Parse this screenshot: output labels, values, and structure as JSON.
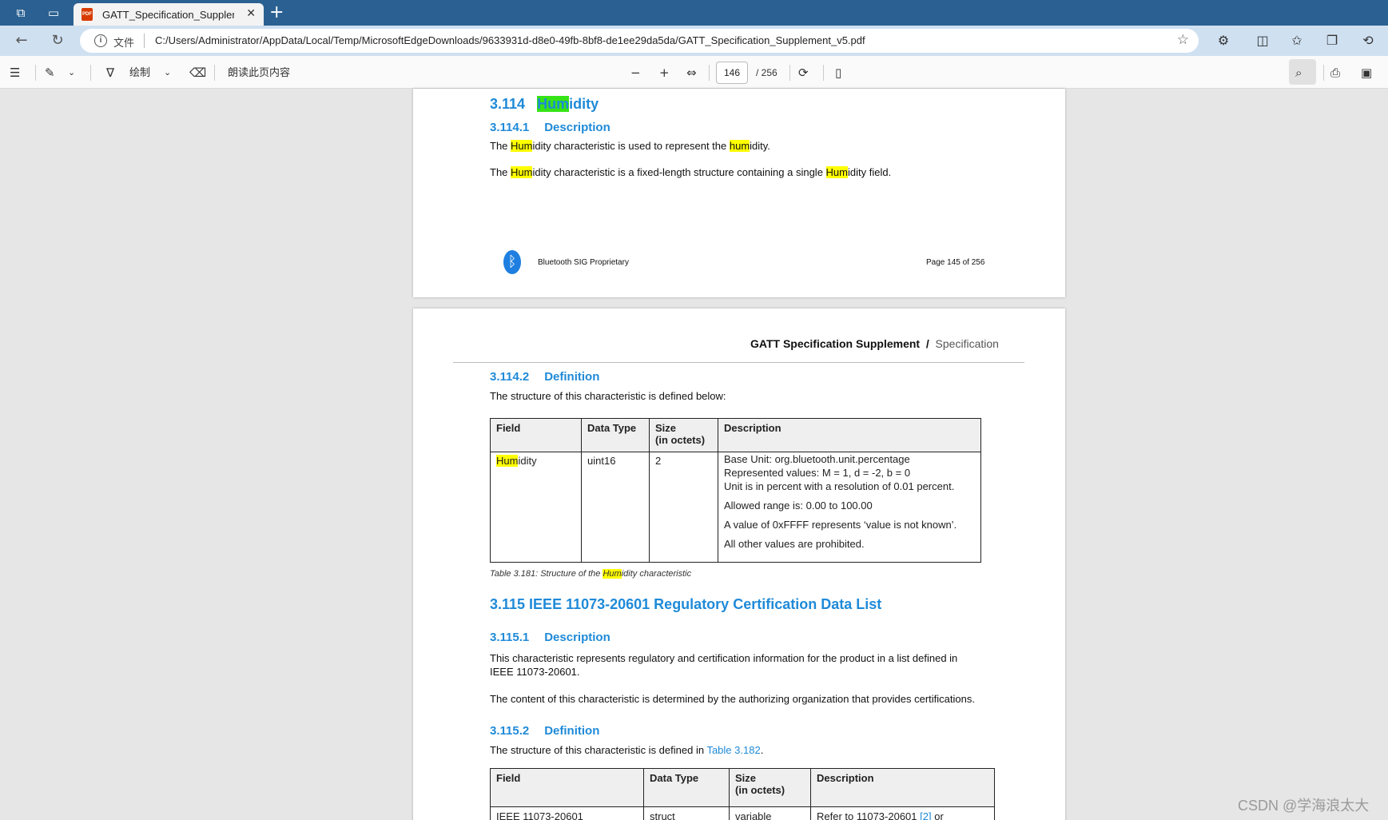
{
  "browser": {
    "tab_title": "GATT_Specification_Supplement_",
    "tab_icon_text": "PDF",
    "address_scheme": "文件",
    "url": "C:/Users/Administrator/AppData/Local/Temp/MicrosoftEdgeDownloads/9633931d-d8e0-49fb-8bf8-de1ee29da5da/GATT_Specification_Supplement_v5.pdf"
  },
  "pdf_toolbar": {
    "draw_label": "绘制",
    "read_aloud_label": "朗读此页内容",
    "page_number": "146",
    "page_total": "/ 256"
  },
  "page1": {
    "heading_num": "3.114",
    "heading_hl": "Hum",
    "heading_rest": "idity",
    "sub_num": "3.114.1",
    "sub_title": "Description",
    "p1_a": "The ",
    "p1_hl1": "Hum",
    "p1_b": "idity characteristic is used to represent the ",
    "p1_hl2": "hum",
    "p1_c": "idity.",
    "p2_a": "The ",
    "p2_hl1": "Hum",
    "p2_b": "idity characteristic is a fixed-length structure containing a single ",
    "p2_hl2": "Hum",
    "p2_c": "idity field.",
    "footer_left": "Bluetooth SIG Proprietary",
    "footer_right": "Page 145 of 256"
  },
  "page2": {
    "header_title": "GATT Specification Supplement",
    "header_sep": "/",
    "header_section": "Specification",
    "def_num": "3.114.2",
    "def_title": "Definition",
    "def_text": "The structure of this characteristic is defined below:",
    "table1": {
      "headers": [
        "Field",
        "Data Type",
        "Size",
        "(in octets)",
        "Description"
      ],
      "field_hl": "Hum",
      "field_rest": "idity",
      "data_type": "uint16",
      "size": "2",
      "desc_line1": "Base Unit: org.bluetooth.unit.percentage",
      "desc_line2": "Represented values: M = 1, d = -2, b = 0",
      "desc_line3": "Unit is in percent with a resolution of 0.01 percent.",
      "desc_line4": "Allowed range is: 0.00 to 100.00",
      "desc_line5": "A value of 0xFFFF represents ‘value is not known’.",
      "desc_line6": "All other values are prohibited."
    },
    "caption_a": "Table 3.181: Structure of the ",
    "caption_hl": "Hum",
    "caption_b": "idity characteristic",
    "h115": "3.115 IEEE 11073-20601 Regulatory Certification Data List",
    "d115_num": "3.115.1",
    "d115_title": "Description",
    "d115_p1_line1": "This characteristic represents regulatory and certification information for the product in a list defined in",
    "d115_p1_line2": "IEEE 11073-20601.",
    "d115_p2": "The content of this characteristic is determined by the authorizing organization that provides certifications.",
    "def115_num": "3.115.2",
    "def115_title": "Definition",
    "def115_text_a": "The structure of this characteristic is defined in ",
    "def115_link": "Table 3.182",
    "def115_text_b": ".",
    "table2": {
      "headers": [
        "Field",
        "Data Type",
        "Size",
        "(in octets)",
        "Description"
      ],
      "row_field": "IEEE 11073-20601",
      "row_type": "struct",
      "row_size": "variable",
      "row_desc_a": "Refer to 11073-20601 ",
      "row_desc_link": "[2]",
      "row_desc_b": " or"
    }
  },
  "watermark": "CSDN @学海浪太大",
  "colors": {
    "heading_blue": "#1f8ad8",
    "highlight_yellow": "#ffff00",
    "highlight_current": "#36e316",
    "titlebar": "#2b6192",
    "addressbar": "#cfe0f1"
  },
  "icons": [
    "workspaces-icon",
    "tab-actions-icon",
    "pdf-file-icon",
    "close-icon",
    "new-tab-icon",
    "back-icon",
    "refresh-icon",
    "info-icon",
    "favorite-star-icon",
    "extensions-icon",
    "split-screen-icon",
    "favorites-icon",
    "collections-icon",
    "history-icon",
    "contents-list-icon",
    "highlight-icon",
    "draw-icon",
    "eraser-icon",
    "zoom-out-icon",
    "zoom-in-icon",
    "fit-width-icon",
    "rotate-icon",
    "page-view-icon",
    "search-icon",
    "print-icon",
    "save-icon",
    "bluetooth-icon"
  ]
}
